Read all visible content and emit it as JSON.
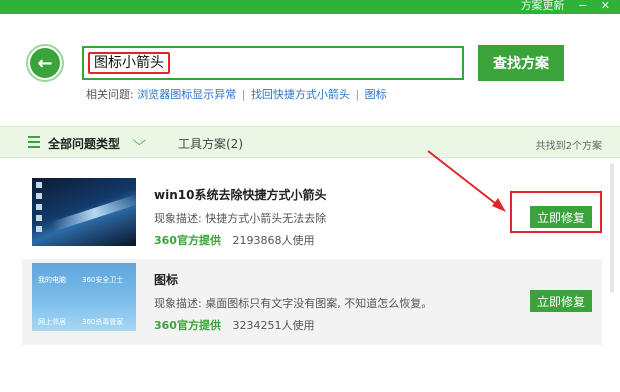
{
  "topbar": {
    "menu_items": [
      "方案更新",
      "−",
      "✕"
    ]
  },
  "search": {
    "value": "图标小箭头",
    "button_label": "查找方案",
    "related_label": "相关问题:",
    "related_links": [
      "浏览器图标显示异常",
      "找回快捷方式小箭头",
      "图标"
    ],
    "separator": "|"
  },
  "filter": {
    "all_types": "全部问题类型",
    "tools_tab": "工具方案(2)",
    "found_text": "共找到2个方案"
  },
  "results": [
    {
      "title": "win10系统去除快捷方式小箭头",
      "description": "现象描述: 快捷方式小箭头无法去除",
      "provider": "360官方提供",
      "users": "2193868人使用",
      "fix_label": "立即修复"
    },
    {
      "title": "图标",
      "description": "现象描述: 桌面图标只有文字没有图案, 不知道怎么恢复。",
      "provider": "360官方提供",
      "users": "3234251人使用",
      "fix_label": "立即修复",
      "thumb_labels": [
        "我的电脑",
        "360安全卫士",
        "网上邻居",
        "360杀毒管家"
      ]
    }
  ],
  "colors": {
    "brand_green": "#3aa43a",
    "highlight_red": "#e0262b",
    "link_blue": "#2b74c7"
  }
}
